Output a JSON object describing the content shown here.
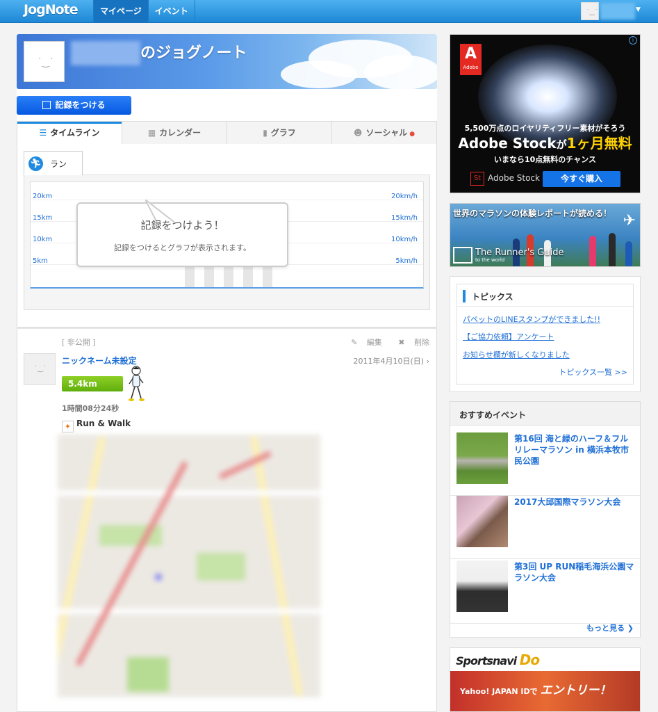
{
  "topbar": {
    "logo": "JogNote",
    "nav": [
      {
        "label": "マイページ",
        "active": true
      },
      {
        "label": "イベント",
        "active": false
      }
    ]
  },
  "hero": {
    "title_suffix": "のジョグノート"
  },
  "record_button": {
    "label": "記録をつける"
  },
  "tabs": [
    {
      "label": "タイムライン",
      "active": true
    },
    {
      "label": "カレンダー"
    },
    {
      "label": "グラフ"
    },
    {
      "label": "ソーシャル",
      "notify": "●"
    }
  ],
  "timeline": {
    "sport_tab": "ラン",
    "y_left": [
      "20km",
      "15km",
      "10km",
      "5km"
    ],
    "y_right": [
      "20km/h",
      "15km/h",
      "10km/h",
      "5km/h"
    ],
    "empty_title": "記録をつけよう！",
    "empty_text": "記録をつけるとグラフが表示されます。"
  },
  "post": {
    "visibility": "[ 非公開 ]",
    "edit_label": "編集",
    "delete_label": "削除",
    "nickname": "ニックネーム未設定",
    "date": "2011年4月10日(日)",
    "distance": "5.4km",
    "duration": "1時間08分24秒",
    "activity": "Run & Walk"
  },
  "ad_adobe": {
    "logo_text": "Adobe",
    "line1": "5,500万点のロイヤリティフリー素材がそろう",
    "line2_a": "Adobe Stock",
    "line2_b": "が",
    "line2_c": "1ヶ月無料",
    "line3": "いまなら10点無料のチャンス",
    "st_badge": "St",
    "st_label": "Adobe Stock",
    "buy_label": "今すぐ購入"
  },
  "ad_runner": {
    "caption": "世界のマラソンの体験レポートが読める！",
    "brand": "The Runner's Guide",
    "brand_sub": "to the world"
  },
  "topics": {
    "heading": "トピックス",
    "links": [
      "パペットのLINEスタンプができました!!",
      "【ご協力依頼】アンケート",
      "お知らせ欄が新しくなりました"
    ],
    "more": "トピックス一覧 >>"
  },
  "events": {
    "heading": "おすすめイベント",
    "items": [
      "第16回 海と緑のハーフ＆フルリレーマラソン in 横浜本牧市民公園",
      "2017大邱国際マラソン大会",
      "第3回 UP RUN稲毛海浜公園マラソン大会"
    ],
    "more": "もっと見る ❯"
  },
  "sportsnavi": {
    "logo": "Sportsnavi",
    "logo_do": "Do",
    "band_prefix": "Yahoo! JAPAN IDで",
    "band_big": "エントリー！"
  }
}
